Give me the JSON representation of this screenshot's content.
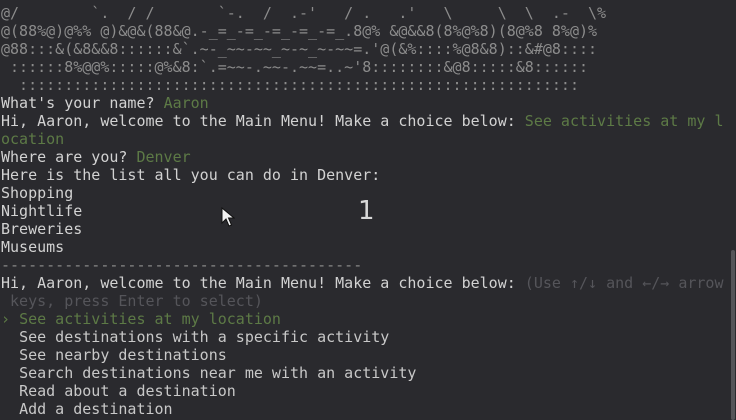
{
  "ascii_art": [
    "@/        `.  / /       `-.  /  .-'   / .   .'   \\     \\  \\  .-  \\%",
    "@(88%@)@%% @)&@&(88&@.-_=_-=_-=_-=_-=_.8@% &@&&8(8%@%8)(8@%8 8%@)%",
    "@88:::&(&8&&8::::::&`.~-_~~-~~_~-~_~-~~=.'@(&%::::%@8&8)::&#@8::::",
    " ::::::8%@@%:::::@%&8:`.=~~-.~~-.~~=..~'8::::::::&@8:::::&8::::::",
    "  ::::::::::::::::::::::::::::::::::::::::::::::::::::::::::::::"
  ],
  "prompt_name": {
    "question": "What's your name?",
    "answer": "Aaron"
  },
  "menu_first": {
    "text": "Hi, Aaron, welcome to the Main Menu! Make a choice below:",
    "answer_line1": "See activities at my l",
    "answer_line2": "ocation"
  },
  "prompt_location": {
    "question": "Where are you?",
    "answer": "Denver"
  },
  "activities": {
    "header": "Here is the list all you can do in Denver:",
    "items": [
      "Shopping",
      "Nightlife",
      "Breweries",
      "Museums"
    ]
  },
  "divider": "----------------------------------------",
  "menu_second": {
    "text": "Hi, Aaron, welcome to the Main Menu! Make a choice below:",
    "hint_line1": "(Use ↑/↓ and ←/→ arrow",
    "hint_line2": " keys, press Enter to select)"
  },
  "options": {
    "selected_marker": "›",
    "selected": "See activities at my location",
    "items": [
      "See destinations with a specific activity",
      "See nearby destinations",
      "Search destinations near me with an activity",
      "Read about a destination",
      "Add a destination"
    ]
  },
  "overlay_label": "1"
}
